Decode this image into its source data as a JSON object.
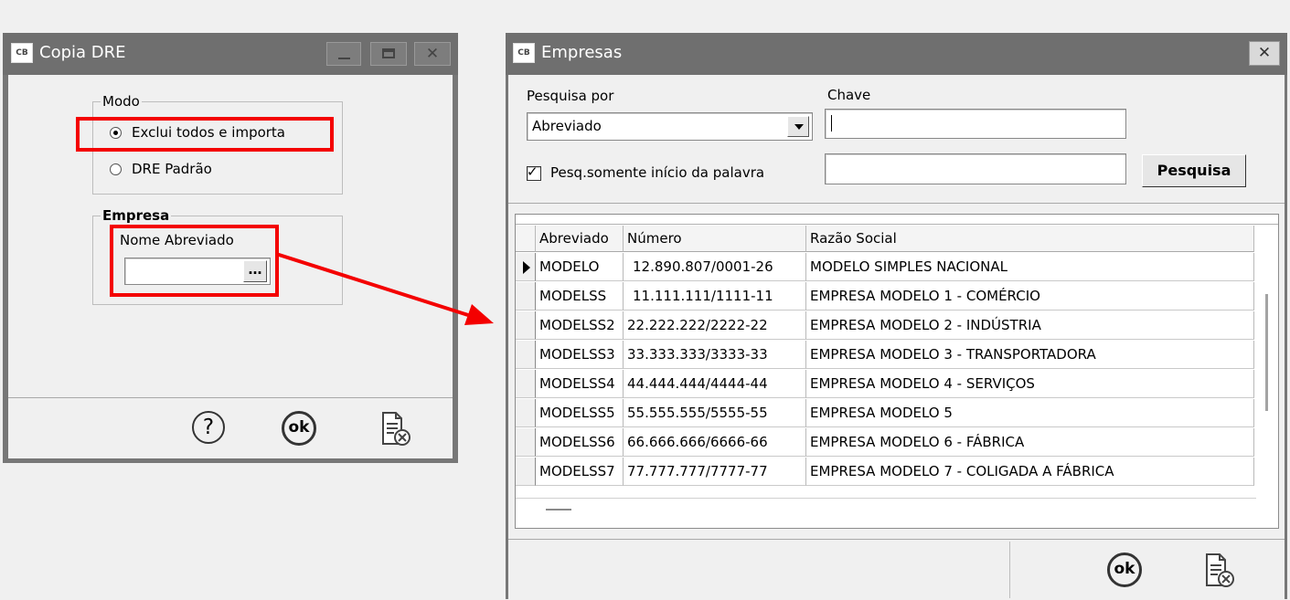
{
  "dre_window": {
    "icon_text": "CB",
    "title": "Copia DRE",
    "modo": {
      "legend": "Modo",
      "option1": "Exclui todos e importa",
      "option2": "DRE Padrão"
    },
    "empresa": {
      "legend": "Empresa",
      "field_label": "Nome Abreviado",
      "field_value": "",
      "browse_label": "…"
    },
    "footer": {
      "help_label": "?",
      "ok_label": "ok"
    }
  },
  "empresas_window": {
    "icon_text": "CB",
    "title": "Empresas",
    "close_label": "✕",
    "search": {
      "by_label": "Pesquisa por",
      "by_value": "Abreviado",
      "key_label": "Chave",
      "key_value": "",
      "key2_value": "",
      "checkbox_label": "Pesq.somente início da palavra",
      "checkbox_checked": true,
      "search_button": "Pesquisa"
    },
    "grid": {
      "columns": [
        "Abreviado",
        "Número",
        "Razão Social"
      ],
      "rows": [
        {
          "abreviado": "MODELO",
          "numero": "12.890.807/0001-26",
          "razao": "MODELO SIMPLES NACIONAL"
        },
        {
          "abreviado": "MODELSS",
          "numero": "11.111.111/1111-11",
          "razao": "EMPRESA MODELO 1 - COMÉRCIO"
        },
        {
          "abreviado": "MODELSS2",
          "numero": "22.222.222/2222-22",
          "razao": "EMPRESA MODELO 2 - INDÚSTRIA"
        },
        {
          "abreviado": "MODELSS3",
          "numero": "33.333.333/3333-33",
          "razao": "EMPRESA MODELO 3 - TRANSPORTADORA"
        },
        {
          "abreviado": "MODELSS4",
          "numero": "44.444.444/4444-44",
          "razao": "EMPRESA MODELO 4 - SERVIÇOS"
        },
        {
          "abreviado": "MODELSS5",
          "numero": "55.555.555/5555-55",
          "razao": "EMPRESA MODELO 5"
        },
        {
          "abreviado": "MODELSS6",
          "numero": "66.666.666/6666-66",
          "razao": "EMPRESA MODELO 6 - FÁBRICA"
        },
        {
          "abreviado": "MODELSS7",
          "numero": "77.777.777/7777-77",
          "razao": "EMPRESA MODELO 7 - COLIGADA A FÁBRICA"
        }
      ]
    },
    "footer": {
      "ok_label": "ok"
    }
  },
  "colors": {
    "titlebar": "#6f6f6f",
    "highlight": "#f40000"
  }
}
